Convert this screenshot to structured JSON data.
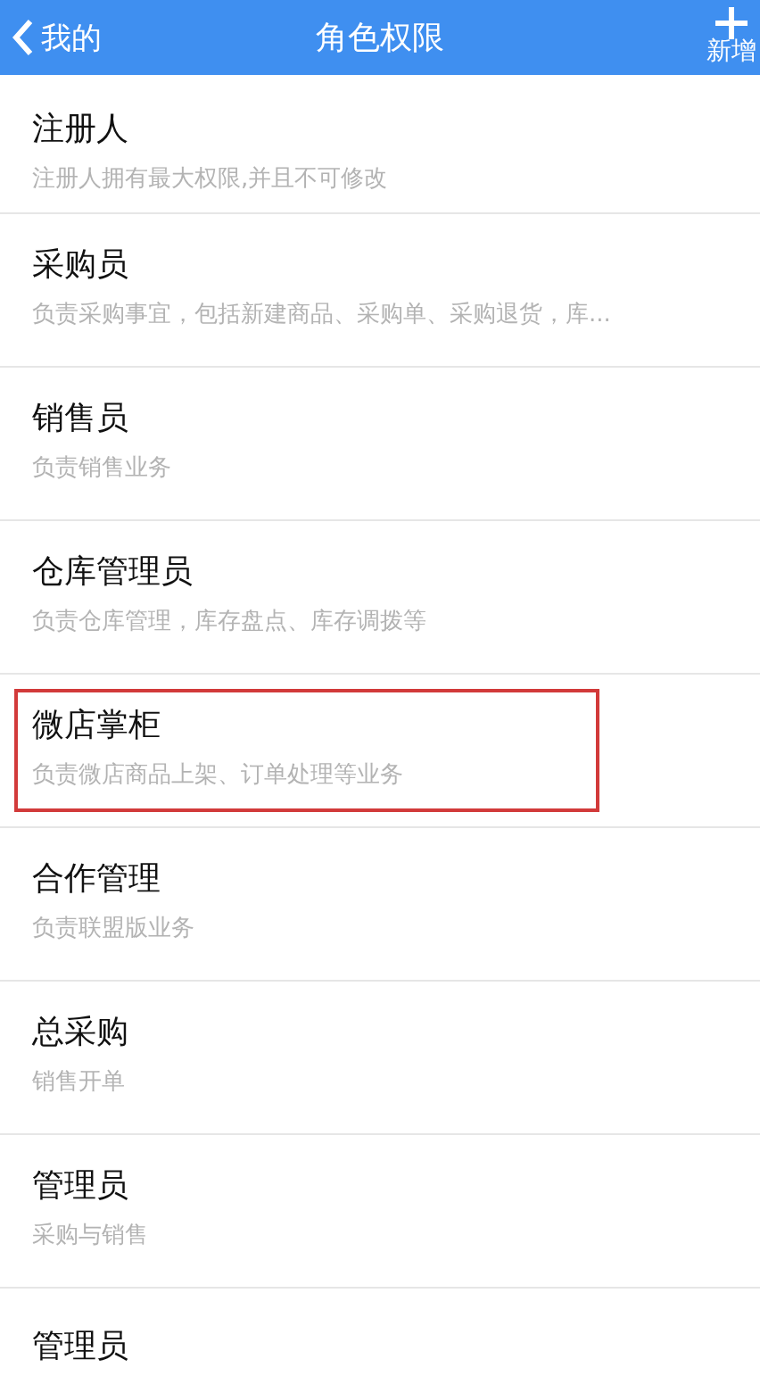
{
  "nav_bar": {
    "back_label": "我的",
    "title": "角色权限",
    "add_label": "新增"
  },
  "roles": [
    {
      "name": "注册人",
      "description": "注册人拥有最大权限,并且不可修改",
      "highlighted": false
    },
    {
      "name": "采购员",
      "description": "负责采购事宜，包括新建商品、采购单、采购退货，库...",
      "highlighted": false
    },
    {
      "name": "销售员",
      "description": "负责销售业务",
      "highlighted": false
    },
    {
      "name": "仓库管理员",
      "description": "负责仓库管理，库存盘点、库存调拨等",
      "highlighted": false
    },
    {
      "name": "微店掌柜",
      "description": "负责微店商品上架、订单处理等业务",
      "highlighted": true
    },
    {
      "name": "合作管理",
      "description": "负责联盟版业务",
      "highlighted": false
    },
    {
      "name": "总采购",
      "description": "销售开单",
      "highlighted": false
    },
    {
      "name": "管理员",
      "description": "采购与销售",
      "highlighted": false
    },
    {
      "name": "管理员",
      "highlighted": false
    }
  ]
}
